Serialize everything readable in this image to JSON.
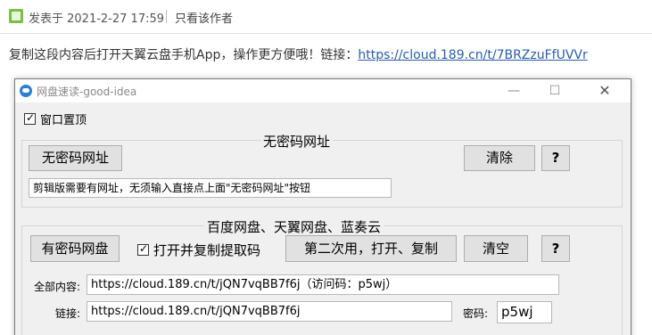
{
  "post": {
    "date": "发表于 2021-2-27 17:59",
    "only_author": "只看该作者",
    "body_text": "复制这段内容后打开天翼云盘手机App，操作更方便哦！链接：",
    "link": "https://cloud.189.cn/t/7BRZzuFfUVVr"
  },
  "window": {
    "title": "网盘速读-good-idea",
    "min": "—",
    "max": "☐",
    "close": "✕",
    "topmost_label": "窗口置顶"
  },
  "group1": {
    "title": "无密码网址",
    "btn_no_pwd": "无密码网址",
    "btn_clear": "清除",
    "btn_help": "?",
    "hint": "剪辑版需要有网址，无须输入直接点上面\"无密码网址\"按钮"
  },
  "group2": {
    "title": "百度网盘、天翼网盘、蓝奏云",
    "btn_has_pwd": "有密码网盘",
    "checkbox_label": "打开并复制提取码",
    "btn_second": "第二次用，打开、复制",
    "btn_empty": "清空",
    "btn_help": "?",
    "label_all": "全部内容:",
    "value_all": "https://cloud.189.cn/t/jQN7vqBB7f6j（访问码：p5wj）",
    "label_link": "链接:",
    "value_link": "https://cloud.189.cn/t/jQN7vqBB7f6j",
    "label_pwd": "密码:",
    "value_pwd": "p5wj"
  }
}
